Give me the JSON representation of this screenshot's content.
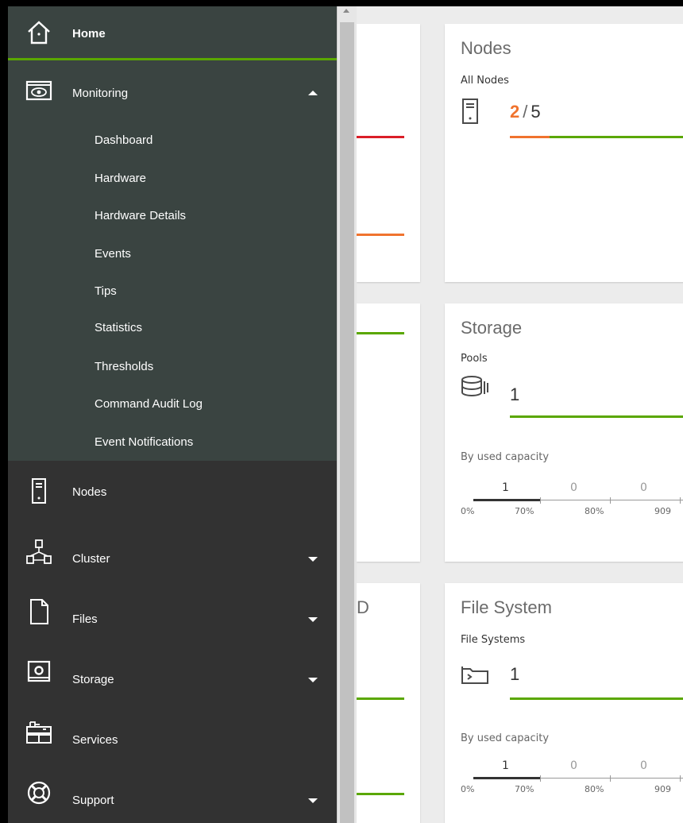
{
  "sidebar": {
    "home": {
      "label": "Home",
      "icon": "home-icon"
    },
    "monitoring": {
      "label": "Monitoring",
      "icon": "eye-icon",
      "expanded": true,
      "items": [
        "Dashboard",
        "Hardware",
        "Hardware Details",
        "Events",
        "Tips",
        "Statistics",
        "Thresholds",
        "Command Audit Log",
        "Event Notifications"
      ]
    },
    "nodes": {
      "label": "Nodes",
      "icon": "server-icon"
    },
    "cluster": {
      "label": "Cluster",
      "icon": "cluster-icon"
    },
    "files": {
      "label": "Files",
      "icon": "file-icon"
    },
    "storage": {
      "label": "Storage",
      "icon": "storage-icon"
    },
    "services": {
      "label": "Services",
      "icon": "services-icon"
    },
    "support": {
      "label": "Support",
      "icon": "lifebuoy-icon"
    }
  },
  "cards": {
    "partial_title": "D",
    "nodes": {
      "title": "Nodes",
      "subtitle": "All Nodes",
      "count_highlight": "2",
      "count_separator": "/",
      "count_total": "5",
      "highlight_fraction": 0.4
    },
    "storage": {
      "title": "Storage",
      "subtitle": "Pools",
      "count": "1",
      "capacity_label": "By used capacity",
      "capacity_values": [
        "1",
        "0",
        "0"
      ],
      "capacity_ticks": [
        "0%",
        "70%",
        "80%",
        "909"
      ]
    },
    "filesystem": {
      "title": "File System",
      "subtitle": "File Systems",
      "count": "1",
      "capacity_label": "By used capacity",
      "capacity_values": [
        "1",
        "0",
        "0"
      ],
      "capacity_ticks": [
        "0%",
        "70%",
        "80%",
        "909"
      ]
    }
  },
  "colors": {
    "sidebar_bg": "#323232",
    "sidebar_active_bg": "#3a4441",
    "accent_green": "#5aa700",
    "warning_orange": "#f0732e",
    "error_red": "#da1e28"
  }
}
